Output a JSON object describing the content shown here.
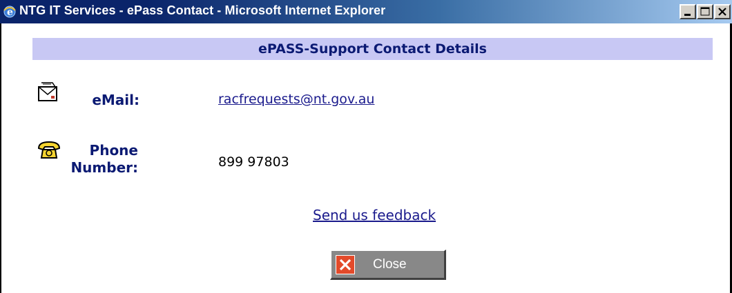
{
  "window": {
    "title": "NTG IT Services - ePass Contact - Microsoft Internet Explorer"
  },
  "header": {
    "title": "ePASS-Support Contact Details"
  },
  "contact": {
    "email_label": "eMail:",
    "email_value": "racfrequests@nt.gov.au",
    "phone_label_line1": "Phone",
    "phone_label_line2": "Number:",
    "phone_value": "899 97803"
  },
  "feedback": {
    "link_text": "Send us feedback"
  },
  "close_button": {
    "label": "Close"
  },
  "colors": {
    "title_bar": "#0a246a",
    "header_band": "#c8c8f4",
    "label_text": "#0b1a73",
    "close_icon": "#e34a2a"
  }
}
